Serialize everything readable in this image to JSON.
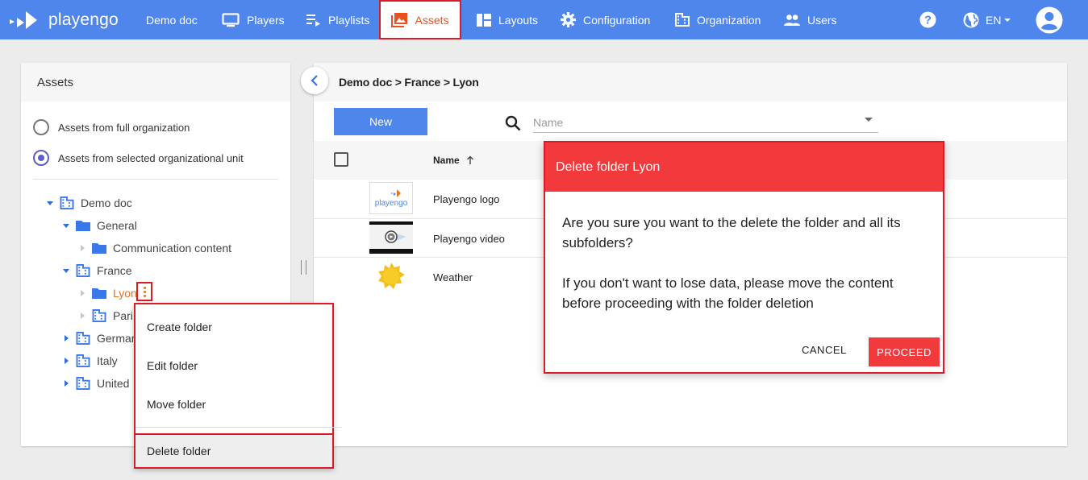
{
  "app": {
    "brand": "playengo",
    "accent": "#4f86ec",
    "active_color": "#e9511c",
    "alert_color": "#f23a3c"
  },
  "nav": {
    "items": [
      {
        "label": "Demo doc",
        "icon": "none"
      },
      {
        "label": "Players",
        "icon": "monitor-icon"
      },
      {
        "label": "Playlists",
        "icon": "playlist-icon"
      },
      {
        "label": "Assets",
        "icon": "image-icon",
        "active": true
      },
      {
        "label": "Layouts",
        "icon": "layout-icon"
      },
      {
        "label": "Configuration",
        "icon": "gear-icon"
      },
      {
        "label": "Organization",
        "icon": "building-icon"
      },
      {
        "label": "Users",
        "icon": "users-icon"
      }
    ],
    "language": "EN"
  },
  "left_panel": {
    "title": "Assets",
    "radio_options": [
      {
        "label": "Assets from full organization",
        "checked": false
      },
      {
        "label": "Assets from selected organizational unit",
        "checked": true
      }
    ],
    "tree": [
      {
        "label": "Demo doc",
        "icon": "building-icon",
        "expanded": true
      },
      {
        "label": "General",
        "icon": "folder-icon",
        "expanded": true
      },
      {
        "label": "Communication content",
        "icon": "folder-icon",
        "expanded": false
      },
      {
        "label": "France",
        "icon": "building-icon",
        "expanded": true
      },
      {
        "label": "Lyon",
        "icon": "folder-icon",
        "selected": true
      },
      {
        "label": "Paris",
        "icon": "building-icon",
        "visible_text": "Pari"
      },
      {
        "label": "Germany",
        "icon": "building-icon",
        "visible_text": "Germar"
      },
      {
        "label": "Italy",
        "icon": "building-icon"
      },
      {
        "label": "United",
        "icon": "building-icon"
      }
    ]
  },
  "context_menu": {
    "items": [
      "Create folder",
      "Edit folder",
      "Move folder"
    ],
    "danger_item": "Delete folder"
  },
  "main": {
    "breadcrumb": "Demo doc > France > Lyon",
    "new_button": "New",
    "search": {
      "placeholder": "Name",
      "value": ""
    },
    "table": {
      "columns": [
        "Name"
      ],
      "sort": "ascending",
      "rows": [
        {
          "name": "Playengo logo",
          "thumb": "logo-thumbnail"
        },
        {
          "name": "Playengo video",
          "thumb": "video-thumbnail"
        },
        {
          "name": "Weather",
          "thumb": "sun-icon"
        }
      ]
    }
  },
  "dialog": {
    "title": "Delete folder Lyon",
    "paragraphs": [
      "Are you sure you want to the delete the folder and all its subfolders?",
      "If you don't want to lose data, please move the content before proceeding with the folder deletion"
    ],
    "cancel_label": "CANCEL",
    "proceed_label": "PROCEED"
  }
}
